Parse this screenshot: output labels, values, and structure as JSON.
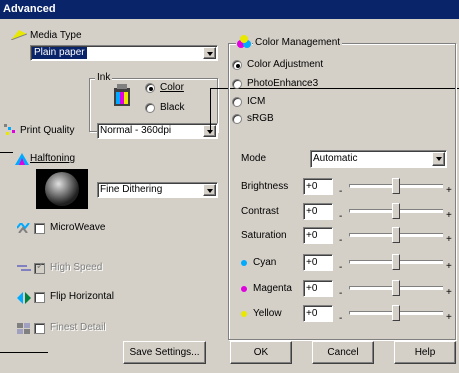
{
  "window": {
    "title": "Advanced"
  },
  "media_type": {
    "label": "Media Type",
    "value": "Plain paper"
  },
  "ink": {
    "group_label": "Ink",
    "color_label": "Color",
    "black_label": "Black",
    "selected": "Color"
  },
  "print_quality": {
    "label": "Print Quality",
    "value": "Normal - 360dpi"
  },
  "halftoning": {
    "label": "Halftoning",
    "value": "Fine Dithering"
  },
  "checkboxes": {
    "microweave": {
      "label": "MicroWeave",
      "checked": false,
      "enabled": true
    },
    "high_speed": {
      "label": "High Speed",
      "checked": true,
      "enabled": false
    },
    "flip_horizontal": {
      "label": "Flip Horizontal",
      "checked": false,
      "enabled": true
    },
    "finest_detail": {
      "label": "Finest Detail",
      "checked": false,
      "enabled": false
    }
  },
  "color_management": {
    "group_label": "Color Management",
    "options": [
      "Color Adjustment",
      "PhotoEnhance3",
      "ICM",
      "sRGB"
    ],
    "selected": "Color Adjustment",
    "mode": {
      "label": "Mode",
      "value": "Automatic"
    },
    "sliders": [
      {
        "label": "Brightness",
        "value": "+0",
        "dot_color": ""
      },
      {
        "label": "Contrast",
        "value": "+0",
        "dot_color": ""
      },
      {
        "label": "Saturation",
        "value": "+0",
        "dot_color": ""
      },
      {
        "label": "Cyan",
        "value": "+0",
        "dot_color": "#00aaff"
      },
      {
        "label": "Magenta",
        "value": "+0",
        "dot_color": "#e000e0"
      },
      {
        "label": "Yellow",
        "value": "+0",
        "dot_color": "#e8e800"
      }
    ],
    "minus": "-",
    "plus": "+"
  },
  "buttons": {
    "save_settings": "Save Settings...",
    "ok": "OK",
    "cancel": "Cancel",
    "help": "Help"
  }
}
